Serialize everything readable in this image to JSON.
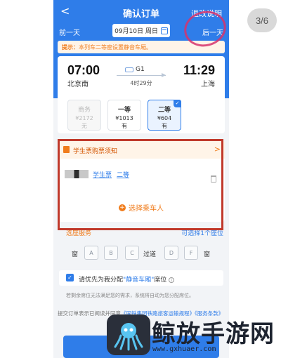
{
  "counter": "3/6",
  "nav": {
    "back": "<",
    "title": "确认订单",
    "refund_link": "退改说明"
  },
  "datebar": {
    "prev": "前一天",
    "date": "09月10日 周日",
    "next": "后一天"
  },
  "tip": {
    "label": "提示：",
    "text": "本列车二等座设置静音车厢。"
  },
  "train": {
    "dep_time": "07:00",
    "dep_station": "北京南",
    "arr_time": "11:29",
    "arr_station": "上海",
    "number": "G1",
    "duration": "4时29分"
  },
  "seats": [
    {
      "name": "商务",
      "price": "¥2172",
      "stock": "无"
    },
    {
      "name": "一等",
      "price": "¥1013",
      "stock": "有"
    },
    {
      "name": "二等",
      "price": "¥604",
      "stock": "有"
    }
  ],
  "student": {
    "title": "学生票购票须知",
    "chevron": ">"
  },
  "passenger": {
    "ticket_type": "学生票",
    "seat_class": "二等"
  },
  "add_passenger": {
    "plus": "+",
    "label": "选择乘车人"
  },
  "seat_service": {
    "label": "选座服务",
    "limit": "可选择1个座位"
  },
  "seat_map": {
    "window": "窗",
    "aisle": "过道",
    "letters": [
      "A",
      "B",
      "C",
      "D",
      "F"
    ]
  },
  "preference": {
    "check": "✓",
    "text_before": "请优先为我分配",
    "highlight": "\"静音车厢\"",
    "text_after": "席位",
    "info": "i",
    "note": "若剩余席位无法满足您的需求，系统将自动为您分配席位。"
  },
  "agreement": {
    "prefix": "提交订单表示已阅读并同意",
    "link1": "《国铁集团铁路旅客运输规程》",
    "link2": "《服务条款》"
  },
  "watermark": {
    "title": "鲸放手游网",
    "url": "www.gxhuaer.com"
  },
  "colors": {
    "brand_blue": "#2f7de9",
    "warning_orange": "#f07c1c",
    "highlight_red": "#c0392b",
    "circle_pink": "#d6336c"
  }
}
